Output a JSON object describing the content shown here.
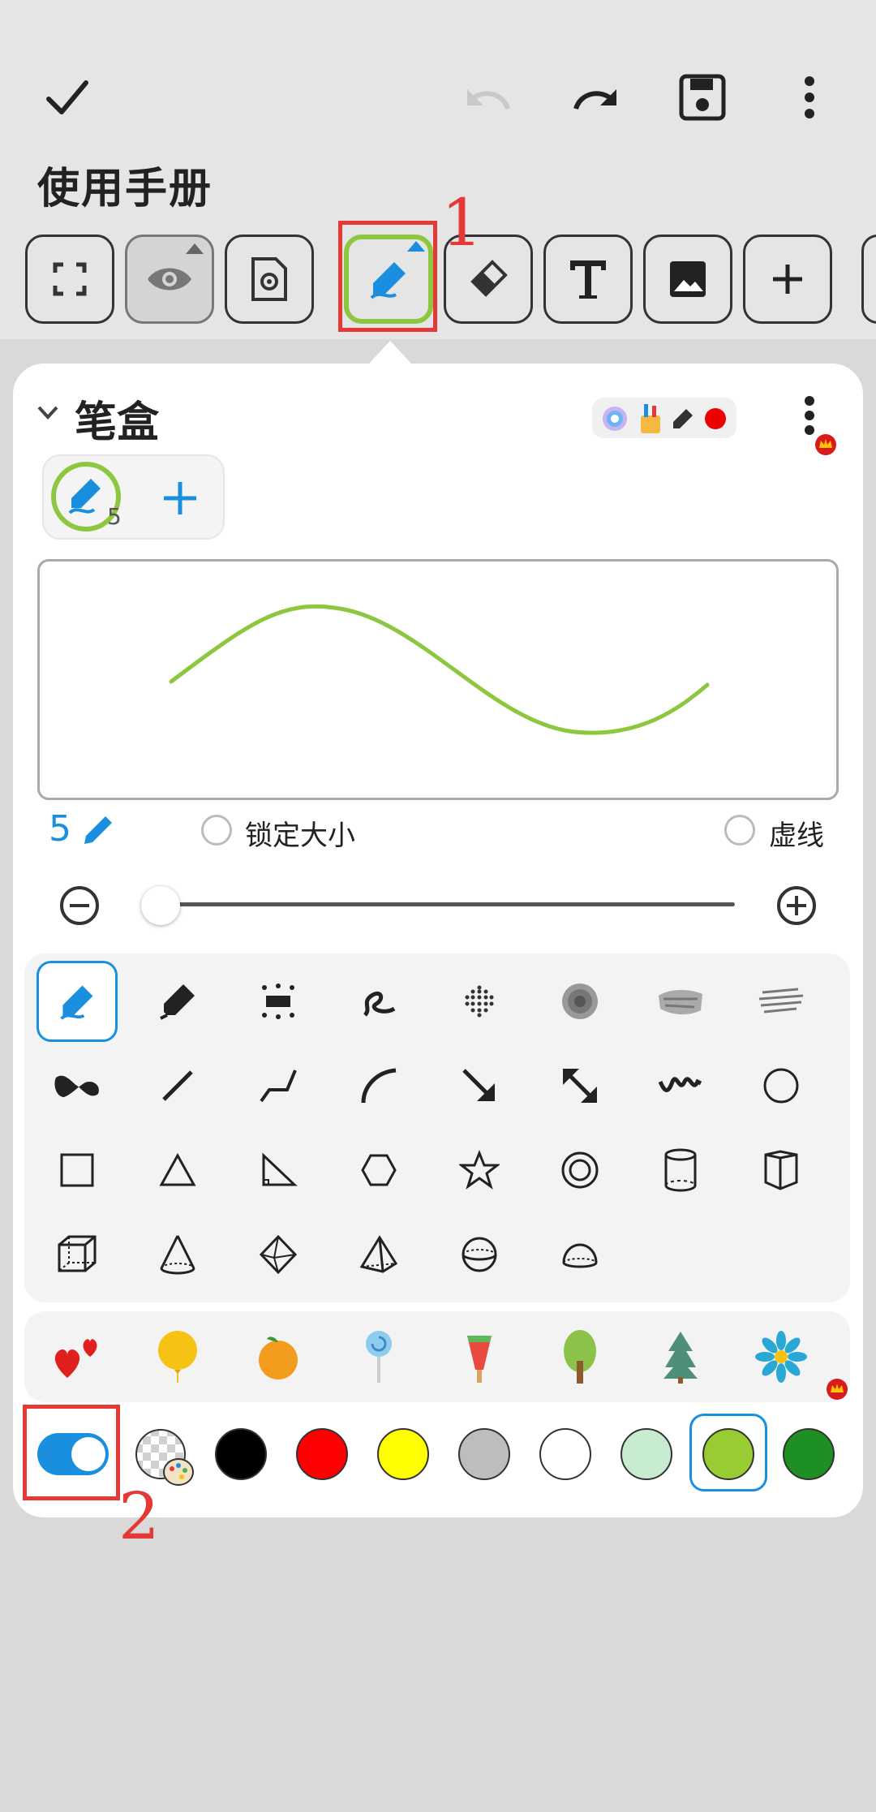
{
  "header": {
    "title": "使用手册"
  },
  "pen_box": {
    "title": "笔盒",
    "pen_size": "5",
    "pen_badge": "5",
    "lock_size_label": "锁定大小",
    "dashed_label": "虚线"
  },
  "annotations": {
    "marker_1": "1",
    "marker_2": "2"
  },
  "colors": {
    "accent": "#1a8fe0",
    "stroke_preview": "#8dc63f",
    "annotation_red": "#e53935",
    "swatches": [
      "#000000",
      "#ff0000",
      "#ffff00",
      "#bdbdbd",
      "#ffffff",
      "#c8ecd0",
      "#99cc33",
      "#1e8f23"
    ],
    "selected_swatch": "#99cc33"
  },
  "toolbar_icons": [
    "check-icon",
    "undo-icon",
    "redo-icon",
    "save-icon",
    "more-icon"
  ],
  "tools": [
    "fullscreen-icon",
    "eye-icon",
    "page-settings-icon",
    "pen-icon",
    "eraser-icon",
    "text-icon",
    "image-icon",
    "add-icon"
  ]
}
